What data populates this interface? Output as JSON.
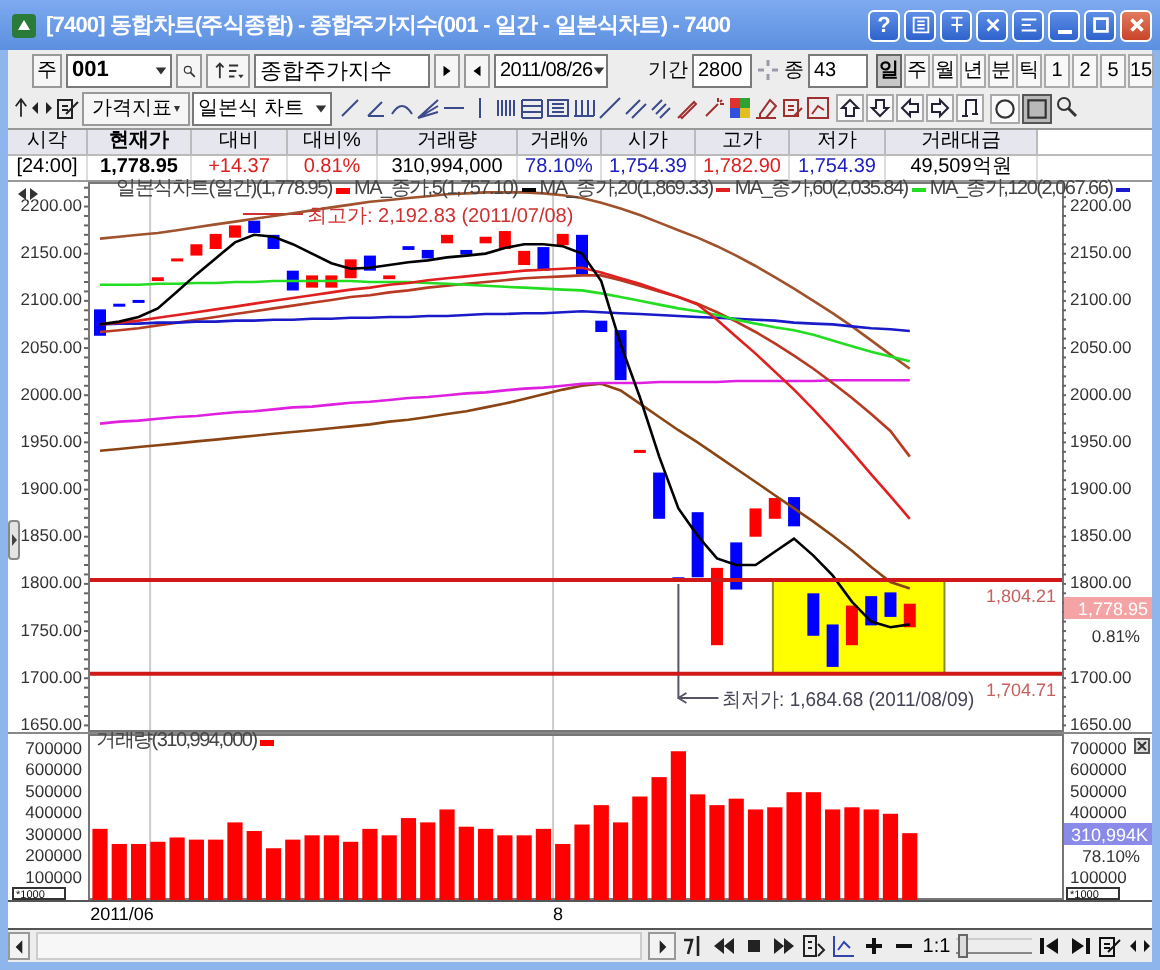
{
  "window": {
    "title": "[7400] 동합차트(주식종합) - 종합주가지수(001 - 일간 - 일본식차트) - 7400",
    "help_button": "?"
  },
  "toolbar": {
    "market_button": "주",
    "code_field": {
      "value": "001"
    },
    "name_field": {
      "value": "종합주가지수"
    },
    "date_field": {
      "value": "2011/08/26"
    },
    "period": {
      "label": "기간",
      "value": "2800"
    },
    "count": {
      "label": "종",
      "value": "43"
    },
    "periods": [
      {
        "label": "일",
        "selected": true
      },
      {
        "label": "주",
        "selected": false
      },
      {
        "label": "월",
        "selected": false
      },
      {
        "label": "년",
        "selected": false
      },
      {
        "label": "분",
        "selected": false
      },
      {
        "label": "틱",
        "selected": false
      },
      {
        "label": "1",
        "selected": false
      },
      {
        "label": "2",
        "selected": false
      },
      {
        "label": "5",
        "selected": false
      },
      {
        "label": "15",
        "selected": false
      }
    ],
    "indicator_button": "가격지표",
    "chart_type": {
      "value": "일본식 차트"
    },
    "shape_tools": [
      {
        "kind": "circle",
        "selected": false
      },
      {
        "kind": "square",
        "selected": true
      }
    ]
  },
  "quote_table": {
    "columns": [
      {
        "label": "시각",
        "emphasis": false
      },
      {
        "label": "현재가",
        "emphasis": true
      },
      {
        "label": "대비",
        "emphasis": false
      },
      {
        "label": "대비%",
        "emphasis": false
      },
      {
        "label": "거래량",
        "emphasis": false
      },
      {
        "label": "거래%",
        "emphasis": false
      },
      {
        "label": "시가",
        "emphasis": false
      },
      {
        "label": "고가",
        "emphasis": false
      },
      {
        "label": "저가",
        "emphasis": false
      },
      {
        "label": "거래대금",
        "emphasis": false
      }
    ],
    "cells": [
      {
        "text": "[24:00]",
        "color": "#000000",
        "emphasis": false
      },
      {
        "text": "1,778.95",
        "color": "#000000",
        "emphasis": true
      },
      {
        "text": "+14.37",
        "color": "#e02020",
        "emphasis": false
      },
      {
        "text": "0.81%",
        "color": "#e02020",
        "emphasis": false
      },
      {
        "text": "310,994,000",
        "color": "#000000",
        "emphasis": false
      },
      {
        "text": "78.10%",
        "color": "#2020c0",
        "emphasis": false
      },
      {
        "text": "1,754.39",
        "color": "#2020c0",
        "emphasis": false
      },
      {
        "text": "1,782.90",
        "color": "#e02020",
        "emphasis": false
      },
      {
        "text": "1,754.39",
        "color": "#2020c0",
        "emphasis": false
      },
      {
        "text": "49,509억원",
        "color": "#000000",
        "emphasis": false
      }
    ]
  },
  "price_chart": {
    "legend": [
      {
        "label": "일본식차트(일간)(1,778.95)",
        "color": "#ff0000"
      }
    ],
    "price_badge": "1,778.95",
    "change_badge": "0.81%",
    "right_axis": [
      "2200.00",
      "2150.00",
      "2100.00",
      "2050.00",
      "2000.00",
      "1950.00",
      "1900.00",
      "1850.00",
      "1800.00",
      "1700.00",
      "1650.00"
    ],
    "chart_data": {
      "type": "line",
      "ylim": [
        1643,
        2226
      ],
      "yticks": [
        {
          "value": 2200,
          "label": "2200.00"
        },
        {
          "value": 2150,
          "label": "2150.00"
        },
        {
          "value": 2100,
          "label": "2100.00"
        },
        {
          "value": 2050,
          "label": "2050.00"
        },
        {
          "value": 2000,
          "label": "2000.00"
        },
        {
          "value": 1950,
          "label": "1950.00"
        },
        {
          "value": 1900,
          "label": "1900.00"
        },
        {
          "value": 1850,
          "label": "1850.00"
        },
        {
          "value": 1800,
          "label": "1800.00"
        },
        {
          "value": 1750,
          "label": "1750.00"
        },
        {
          "value": 1700,
          "label": "1700.00"
        },
        {
          "value": 1650,
          "label": "1650.00"
        }
      ],
      "series": [
        {
          "name": "MA_종가,5(1,757.10)",
          "color": "#000000",
          "values": [
            2075,
            2078,
            2083,
            2092,
            2110,
            2128,
            2145,
            2162,
            2170,
            2168,
            2160,
            2150,
            2140,
            2134,
            2135,
            2138,
            2141,
            2143,
            2146,
            2148,
            2150,
            2156,
            2160,
            2160,
            2158,
            2150,
            2121,
            2054,
            1998,
            1935,
            1880,
            1851,
            1827,
            1820,
            1820,
            1834,
            1848,
            1830,
            1809,
            1781,
            1760,
            1754,
            1757
          ]
        },
        {
          "name": "MA_종가,20(1,869.33)",
          "color": "#e02020",
          "values": [
            2075,
            2077,
            2079,
            2082,
            2085,
            2088,
            2091,
            2094,
            2097,
            2100,
            2103,
            2106,
            2109,
            2112,
            2114,
            2117,
            2119,
            2122,
            2124,
            2126,
            2128,
            2130,
            2132,
            2133,
            2134,
            2135,
            2130,
            2124,
            2118,
            2111,
            2104,
            2096,
            2080,
            2062,
            2044,
            2025,
            2006,
            1985,
            1963,
            1940,
            1916,
            1893,
            1869
          ]
        },
        {
          "name": "MA_종가,60(2,035.84)",
          "color": "#22dd22",
          "values": [
            2117,
            2117,
            2117,
            2118,
            2118,
            2119,
            2119,
            2120,
            2120,
            2121,
            2121,
            2121,
            2121,
            2121,
            2120,
            2120,
            2120,
            2119,
            2118,
            2117,
            2116,
            2115,
            2114,
            2113,
            2112,
            2111,
            2108,
            2104,
            2100,
            2096,
            2092,
            2089,
            2085,
            2080,
            2076,
            2072,
            2069,
            2064,
            2058,
            2052,
            2046,
            2041,
            2036
          ]
        },
        {
          "name": "MA_종가,120(2,067.66)",
          "color": "#1a1ac8",
          "values": [
            2075,
            2076,
            2076,
            2077,
            2077,
            2078,
            2078,
            2079,
            2079,
            2080,
            2080,
            2081,
            2081,
            2082,
            2082,
            2083,
            2083,
            2084,
            2084,
            2085,
            2086,
            2086,
            2087,
            2087,
            2088,
            2089,
            2088,
            2087,
            2086,
            2085,
            2084,
            2083,
            2082,
            2081,
            2080,
            2079,
            2077,
            2076,
            2075,
            2073,
            2071,
            2070,
            2068
          ]
        },
        {
          "color": "#a0522d",
          "values": [
            2166,
            2168,
            2170,
            2172,
            2175,
            2178,
            2181,
            2184,
            2187,
            2190,
            2193,
            2196,
            2199,
            2202,
            2205,
            2207,
            2209,
            2211,
            2213,
            2214,
            2215,
            2215,
            2215,
            2214,
            2212,
            2209,
            2204,
            2198,
            2191,
            2183,
            2175,
            2167,
            2158,
            2148,
            2137,
            2125,
            2113,
            2100,
            2087,
            2073,
            2058,
            2043,
            2028
          ]
        },
        {
          "color": "#b83a22",
          "values": [
            2067,
            2069,
            2071,
            2074,
            2077,
            2080,
            2083,
            2086,
            2089,
            2092,
            2095,
            2098,
            2101,
            2104,
            2106,
            2109,
            2111,
            2114,
            2116,
            2118,
            2120,
            2122,
            2124,
            2125,
            2126,
            2127,
            2127,
            2122,
            2116,
            2110,
            2104,
            2097,
            2088,
            2078,
            2067,
            2055,
            2042,
            2028,
            2013,
            1997,
            1980,
            1962,
            1935
          ]
        },
        {
          "color": "#e020e0",
          "values": [
            1970,
            1972,
            1973,
            1975,
            1977,
            1978,
            1980,
            1982,
            1983,
            1985,
            1987,
            1988,
            1990,
            1992,
            1993,
            1995,
            1997,
            1998,
            2000,
            2002,
            2003,
            2005,
            2007,
            2008,
            2010,
            2012,
            2013,
            2013,
            2013,
            2014,
            2014,
            2014,
            2014,
            2015,
            2015,
            2015,
            2015,
            2015,
            2016,
            2016,
            2016,
            2016,
            2016
          ]
        },
        {
          "color": "#8b4513",
          "values": [
            1941,
            1943,
            1945,
            1947,
            1949,
            1951,
            1953,
            1955,
            1957,
            1959,
            1961,
            1963,
            1965,
            1967,
            1969,
            1972,
            1974,
            1977,
            1980,
            1983,
            1987,
            1991,
            1996,
            2001,
            2006,
            2010,
            2012,
            2005,
            1991,
            1977,
            1963,
            1950,
            1936,
            1922,
            1908,
            1894,
            1880,
            1866,
            1851,
            1835,
            1818,
            1802,
            1795
          ]
        }
      ],
      "ref_lines": [
        {
          "axis": "y",
          "value": 1804.21,
          "label": "1,804.21"
        },
        {
          "axis": "y",
          "value": 1704.71,
          "label": "1,704.71"
        }
      ],
      "legend": "top",
      "annotations": [
        "최고가: 2,192.83 (2011/07/08)",
        "최저가: 1,684.68 (2011/08/09)"
      ]
    }
  },
  "volume_chart": {
    "legend": [
      {
        "label": "거래량(310,994,000)",
        "color": "#ff0000"
      }
    ],
    "unit_labels": [
      "*1000",
      "*1000"
    ],
    "volume_badge": "310,994K",
    "ratio_badge": "78.10%",
    "right_axis": [
      "700000",
      "600000",
      "500000",
      "400000",
      "100000"
    ],
    "chart_data": {
      "type": "bar",
      "ylim": [
        0,
        770000
      ],
      "yticks": [
        100000,
        200000,
        300000,
        400000,
        500000,
        600000,
        700000
      ],
      "series": [
        {
          "color": "#ff0000",
          "values": [
            330000,
            260000,
            260000,
            270000,
            290000,
            280000,
            280000,
            360000,
            320000,
            240000,
            280000,
            300000,
            300000,
            270000,
            330000,
            300000,
            380000,
            360000,
            420000,
            340000,
            330000,
            300000,
            300000,
            330000,
            260000,
            350000,
            440000,
            360000,
            480000,
            570000,
            690000,
            490000,
            440000,
            470000,
            420000,
            430000,
            500000,
            500000,
            420000,
            430000,
            420000,
            400000,
            310000
          ]
        }
      ]
    }
  },
  "date_axis": [
    {
      "label": "2011/06"
    },
    {
      "label": "8"
    }
  ],
  "bottom_bar": {
    "zoom_label": "1:1",
    "zoom_slider": {
      "level": 0.03
    }
  }
}
